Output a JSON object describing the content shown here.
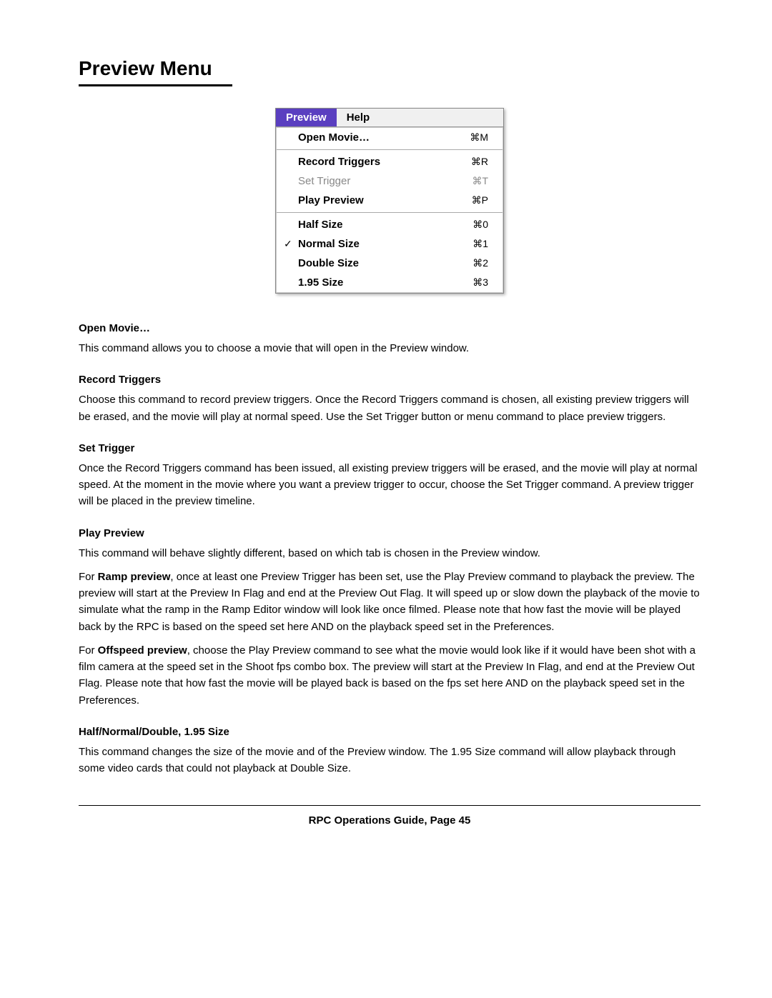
{
  "page": {
    "title": "Preview Menu",
    "title_underline": true
  },
  "menu": {
    "bar_items": [
      {
        "label": "Preview",
        "active": true
      },
      {
        "label": "Help",
        "active": false
      }
    ],
    "items": [
      {
        "label": "Open Movie…",
        "shortcut": "⌘M",
        "bold": true,
        "grayed": false,
        "checkmark": false,
        "separator_before": false
      },
      {
        "label": "Record Triggers",
        "shortcut": "⌘R",
        "bold": true,
        "grayed": false,
        "checkmark": false,
        "separator_before": true
      },
      {
        "label": "Set Trigger",
        "shortcut": "⌘T",
        "bold": false,
        "grayed": true,
        "checkmark": false,
        "separator_before": false
      },
      {
        "label": "Play Preview",
        "shortcut": "⌘P",
        "bold": true,
        "grayed": false,
        "checkmark": false,
        "separator_before": false
      },
      {
        "label": "Half Size",
        "shortcut": "⌘0",
        "bold": true,
        "grayed": false,
        "checkmark": false,
        "separator_before": true
      },
      {
        "label": "Normal Size",
        "shortcut": "⌘1",
        "bold": true,
        "grayed": false,
        "checkmark": true,
        "separator_before": false
      },
      {
        "label": "Double Size",
        "shortcut": "⌘2",
        "bold": true,
        "grayed": false,
        "checkmark": false,
        "separator_before": false
      },
      {
        "label": "1.95 Size",
        "shortcut": "⌘3",
        "bold": true,
        "grayed": false,
        "checkmark": false,
        "separator_before": false
      }
    ]
  },
  "sections": [
    {
      "id": "open-movie",
      "title": "Open Movie…",
      "paragraphs": [
        "This command allows you to choose a movie that will open in the Preview window."
      ]
    },
    {
      "id": "record-triggers",
      "title": "Record Triggers",
      "paragraphs": [
        "Choose this command to record preview triggers. Once the Record Triggers command is chosen, all existing preview triggers will be erased, and the movie will play at normal speed. Use the Set Trigger button or menu command to place preview triggers."
      ]
    },
    {
      "id": "set-trigger",
      "title": "Set Trigger",
      "paragraphs": [
        "Once the Record Triggers command has been issued, all existing preview triggers will be erased, and the movie will play at normal speed. At the moment in the movie where you want a preview trigger to occur, choose the Set Trigger command. A preview trigger will be placed in the preview timeline."
      ]
    },
    {
      "id": "play-preview",
      "title": "Play Preview",
      "paragraphs": [
        "This command will behave slightly different, based on which tab is chosen in the Preview window.",
        "For __Ramp preview__, once at least one Preview Trigger has been set, use the Play Preview command to playback the preview. The preview will start at the Preview In Flag and end at the Preview Out Flag. It will speed up or slow down the playback of the movie to simulate what the ramp in the Ramp Editor window will look like once filmed. Please note that how fast the movie will be played back by the RPC is based on the speed set here AND on the playback speed set in the Preferences.",
        "For __Offspeed preview__, choose the Play Preview command to see what the movie would look like if it would have been shot with a film camera at the speed set in the Shoot fps combo box. The preview will start at the Preview In Flag, and end at the Preview Out Flag. Please note that how fast the movie will be played back is based on the fps set here AND on the playback speed set in the Preferences."
      ]
    },
    {
      "id": "half-normal-double",
      "title": "Half/Normal/Double, 1.95 Size",
      "paragraphs": [
        "This command changes the size of the movie and of the Preview window. The 1.95 Size command will allow playback through some video cards that could not playback at Double Size."
      ]
    }
  ],
  "footer": {
    "text": "RPC Operations Guide, Page 45"
  },
  "play_preview_paragraphs": {
    "p1": "This command will behave slightly different, based on which tab is chosen in the Preview window.",
    "p2_prefix": "For ",
    "p2_bold": "Ramp preview",
    "p2_suffix": ", once at least one Preview Trigger has been set, use the Play Preview command to playback the preview. The preview will start at the Preview In Flag and end at the Preview Out Flag. It will speed up or slow down the playback of the movie to simulate what the ramp in the Ramp Editor window will look like once filmed. Please note that how fast the movie will be played back by the RPC is based on the speed set here AND on the playback speed set in the Preferences.",
    "p3_prefix": "For ",
    "p3_bold": "Offspeed preview",
    "p3_suffix": ", choose the Play Preview command to see what the movie would look like if it would have been shot with a film camera at the speed set in the Shoot fps combo box. The preview will start at the Preview In Flag, and end at the Preview Out Flag. Please note that how fast the movie will be played back is based on the fps set here AND on the playback speed set in the Preferences."
  }
}
